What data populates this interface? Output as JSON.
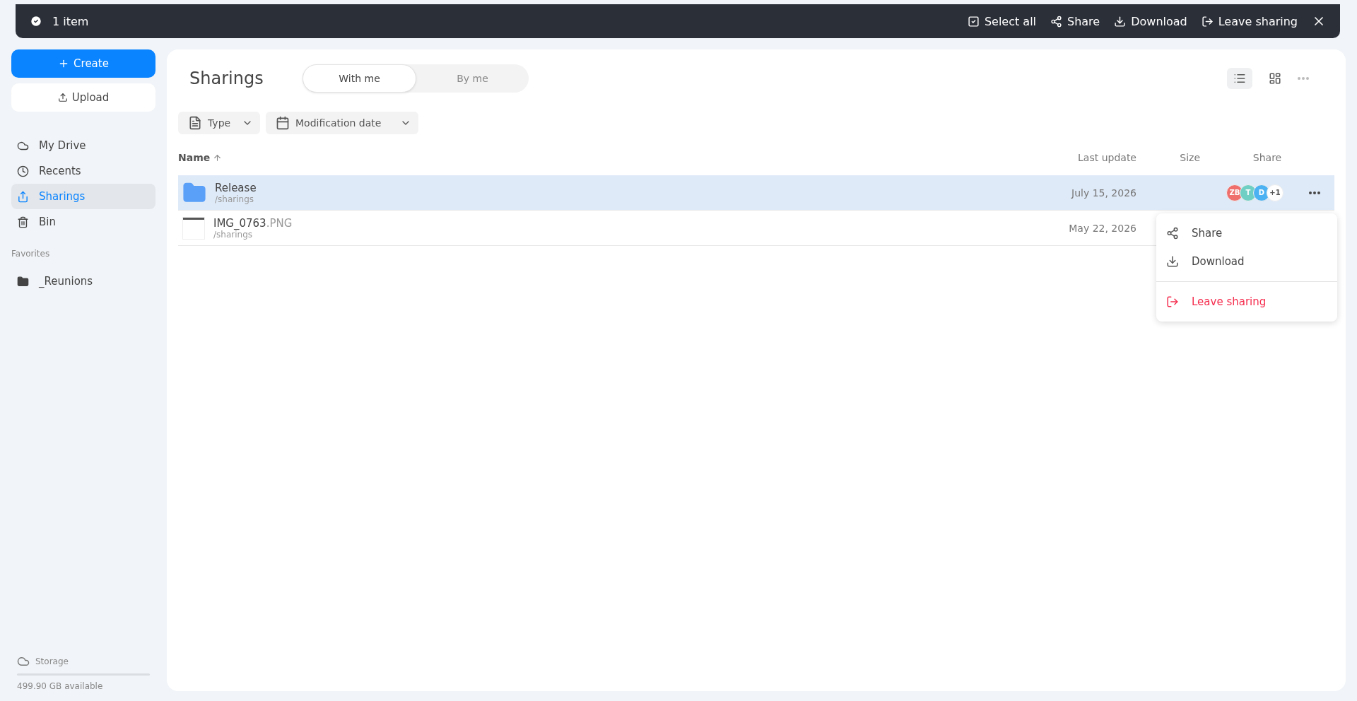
{
  "selection_bar": {
    "count": "1 item",
    "actions": [
      {
        "label": "Select all"
      },
      {
        "label": "Share"
      },
      {
        "label": "Download"
      },
      {
        "label": "Leave sharing"
      }
    ]
  },
  "sidebar": {
    "create": "Create",
    "upload": "Upload",
    "nav": [
      {
        "label": "My Drive",
        "selected": false
      },
      {
        "label": "Recents",
        "selected": false
      },
      {
        "label": "Sharings",
        "selected": true
      },
      {
        "label": "Bin",
        "selected": false
      }
    ],
    "favorites_title": "Favorites",
    "favorites": [
      {
        "label": "_Reunions"
      }
    ],
    "storage": {
      "title": "Storage",
      "available": "499.90 GB available"
    }
  },
  "page": {
    "title": "Sharings",
    "tabs": [
      {
        "label": "With me",
        "selected": true
      },
      {
        "label": "By me",
        "selected": false
      }
    ],
    "views": [
      {
        "selected": true
      },
      {
        "selected": false
      }
    ],
    "filters": [
      {
        "label": "Type"
      },
      {
        "label": "Modification date"
      }
    ],
    "columns": {
      "name": "Name",
      "last_update": "Last update",
      "size": "Size",
      "share": "Share"
    },
    "rows": [
      {
        "kind": "folder",
        "name": "Release",
        "path": "/sharings",
        "date": "July 15, 2026",
        "selected": true,
        "avatars": [
          {
            "text": "ZB",
            "color": "#ef6f6c"
          },
          {
            "text": "T",
            "color": "#6fcfc4"
          },
          {
            "text": "D",
            "color": "#4db2f2"
          },
          {
            "text": "+1",
            "color": "#ffffff"
          }
        ]
      },
      {
        "kind": "image",
        "name": "IMG_0763",
        "ext": ".PNG",
        "path": "/sharings",
        "date": "May 22, 2026",
        "selected": false,
        "avatars": []
      }
    ],
    "menu": [
      {
        "label": "Share",
        "kind": "normal"
      },
      {
        "label": "Download",
        "kind": "normal"
      },
      {
        "label": "Leave sharing",
        "kind": "danger"
      }
    ]
  }
}
